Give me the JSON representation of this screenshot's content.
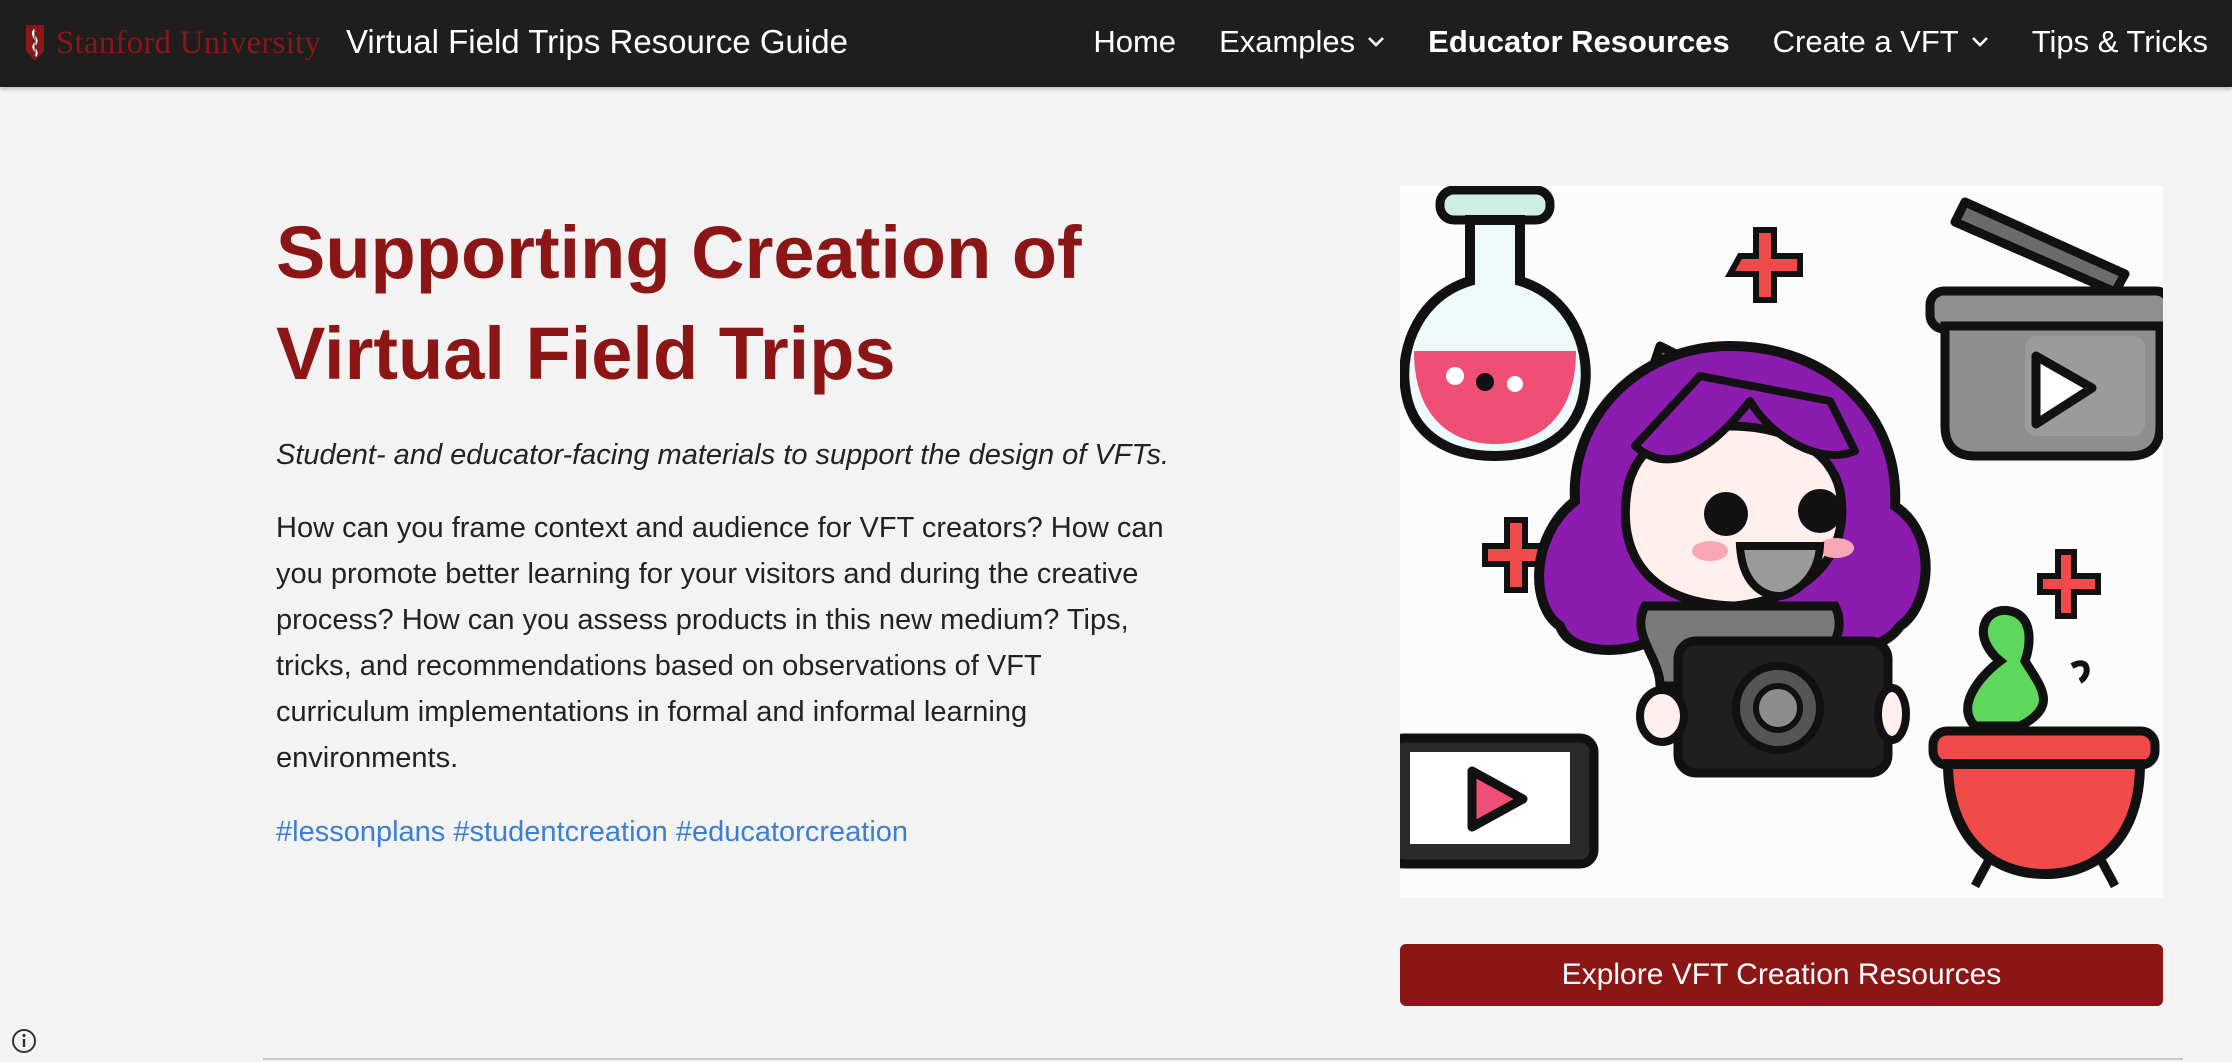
{
  "header": {
    "logo_text": "Stanford University",
    "site_title": "Virtual Field Trips Resource Guide",
    "nav": [
      {
        "label": "Home"
      },
      {
        "label": "Examples"
      },
      {
        "label": "Educator Resources"
      },
      {
        "label": "Create a VFT"
      },
      {
        "label": "Tips & Tricks"
      }
    ]
  },
  "hero": {
    "title_line1": "Supporting Creation of",
    "title_line2": "Virtual Field Trips",
    "subtitle": "Student- and educator-facing materials to support the design of VFTs.",
    "body": "How can you frame context and audience for VFT creators? How can you promote better learning for your visitors and during the creative process? How can you assess products in this new medium? Tips, tricks, and recommendations based on observations of VFT curriculum implementations in formal and informal learning environments.",
    "hashtags": [
      "#lessonplans",
      "#studentcreation",
      "#educatorcreation"
    ],
    "cta_label": "Explore VFT Creation Resources"
  },
  "colors": {
    "header_bg": "#1e1e1e",
    "brand_red": "#8c1515",
    "hashtag_blue": "#3b7fd4",
    "page_bg": "#f3f3f3"
  },
  "icons": [
    "stanford-tree-logo-icon",
    "chevron-down-icon",
    "info-icon"
  ]
}
